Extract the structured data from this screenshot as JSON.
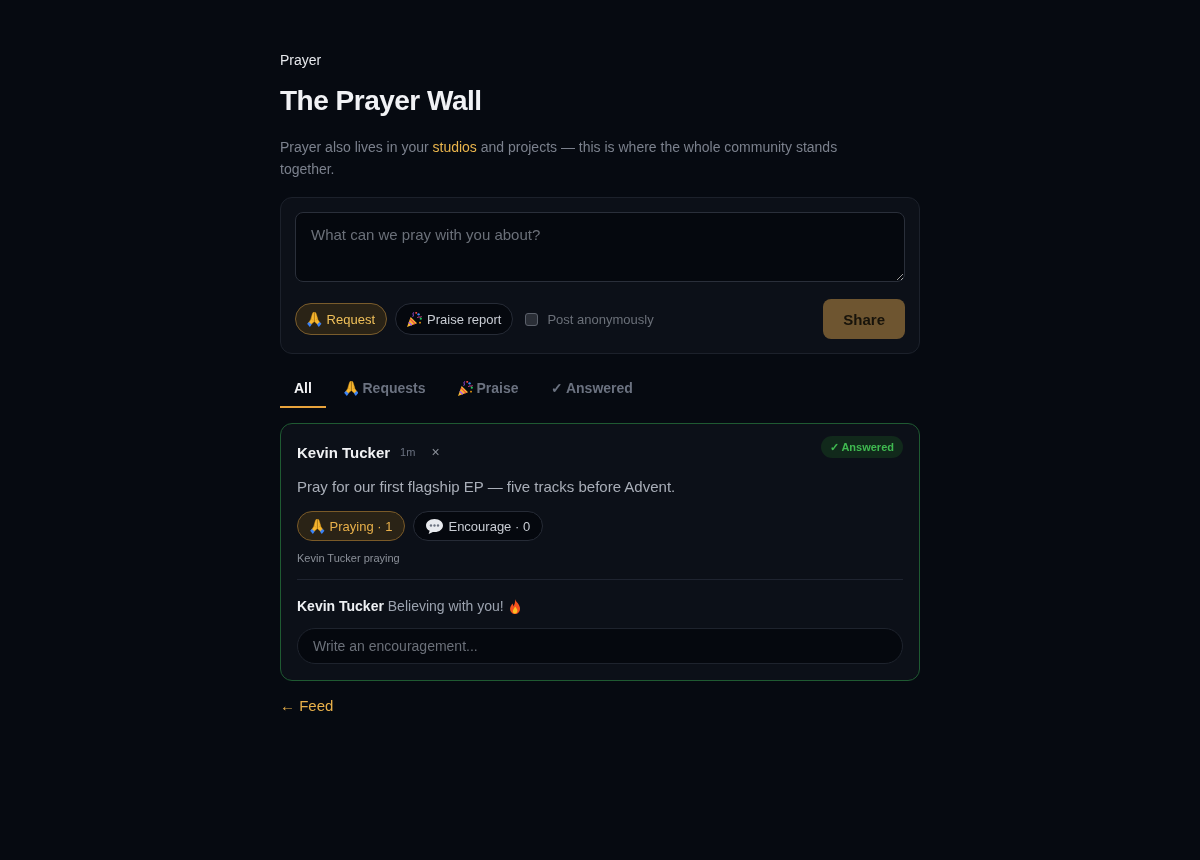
{
  "breadcrumb": "Prayer",
  "title": "The Prayer Wall",
  "intro": {
    "before": "Prayer also lives in your ",
    "link": "studios",
    "after": " and projects — this is where the whole community stands together."
  },
  "composer": {
    "placeholder": "What can we pray with you about?",
    "types": [
      {
        "kind": "request",
        "label": "Request",
        "selected": true
      },
      {
        "kind": "praise",
        "label": "Praise report",
        "selected": false
      }
    ],
    "anonymous": {
      "label": "Post anonymously",
      "checked": false
    },
    "submit": "Share"
  },
  "tabs": [
    {
      "kind": "all",
      "label": "All",
      "selected": true
    },
    {
      "kind": "request",
      "label": "Requests",
      "selected": false
    },
    {
      "kind": "praise",
      "label": "Praise",
      "selected": false
    },
    {
      "kind": "answered",
      "label": "✓ Answered",
      "selected": false
    }
  ],
  "posts": [
    {
      "author": "Kevin Tucker",
      "time": "1m",
      "delete": "×",
      "answered": true,
      "badge": "✓ Answered",
      "text": "Pray for our first flagship EP — five tracks before Advent.",
      "reactions": [
        {
          "kind": "pray",
          "label": "Praying · 1",
          "selected": true
        },
        {
          "kind": "encourage",
          "label": "Encourage · 0",
          "selected": false
        }
      ],
      "praying_note": "Kevin Tucker praying",
      "comments": [
        {
          "kind": "fire",
          "author": "Kevin Tucker",
          "text": "Believing with you!"
        }
      ],
      "reply_placeholder": "Write an encouragement..."
    }
  ],
  "back_link": "← Feed"
}
